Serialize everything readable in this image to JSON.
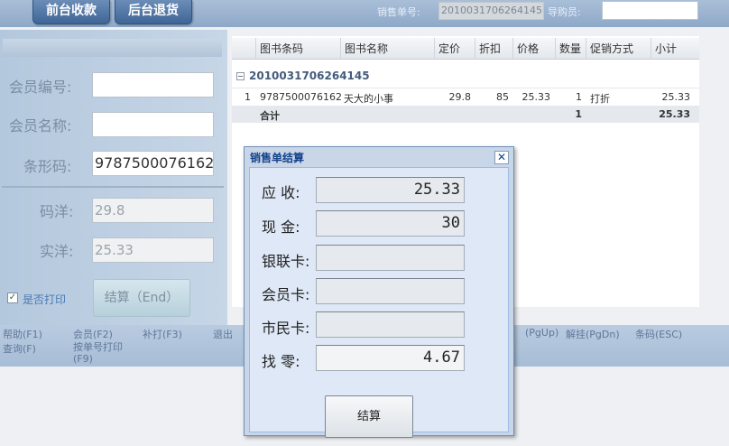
{
  "topbar": {
    "tab_front": "前台收款",
    "tab_back": "后台退货",
    "sale_no_label": "销售单号:",
    "sale_no_value": "2010031706264145",
    "guide_label": "导购员:",
    "guide_value": ""
  },
  "left": {
    "member_no_label": "会员编号:",
    "member_no_value": "",
    "member_name_label": "会员名称:",
    "member_name_value": "",
    "barcode_label": "条形码:",
    "barcode_value": "9787500076162",
    "list_price_label": "码洋:",
    "list_price_value": "29.8",
    "real_price_label": "实洋:",
    "real_price_value": "25.33",
    "print_label": "是否打印",
    "print_checked": true,
    "checkout_button": "结算（End）"
  },
  "grid": {
    "columns": [
      "图书条码",
      "图书名称",
      "定价",
      "折扣",
      "价格",
      "数量",
      "促销方式",
      "小计"
    ],
    "group": "2010031706264145",
    "rows": [
      {
        "no": "1",
        "barcode": "9787500076162",
        "name": "天大的小事",
        "list_price": "29.8",
        "discount": "85",
        "price": "25.33",
        "qty": "1",
        "promo": "打折",
        "subtotal": "25.33"
      }
    ],
    "total": {
      "label": "合计",
      "qty": "1",
      "subtotal": "25.33"
    }
  },
  "footer": {
    "help": "帮助(F1)",
    "query": "查询(F)",
    "member": "会员(F2)",
    "print_by_no": "按单号打印",
    "print_by_no_key": "(F9)",
    "reprint": "补打(F3)",
    "exit": "退出",
    "pgup": "(PgUp)",
    "release": "解挂(PgDn)",
    "barcode": "条码(ESC)"
  },
  "dialog": {
    "title": "销售单结算",
    "receivable_label": "应 收:",
    "receivable_value": "25.33",
    "cash_label": "现 金:",
    "cash_value": "30",
    "unionpay_label": "银联卡:",
    "unionpay_value": "",
    "member_card_label": "会员卡:",
    "member_card_value": "",
    "citizen_card_label": "市民卡:",
    "citizen_card_value": "",
    "change_label": "找 零:",
    "change_value": "4.67",
    "ok_button": "结算"
  }
}
